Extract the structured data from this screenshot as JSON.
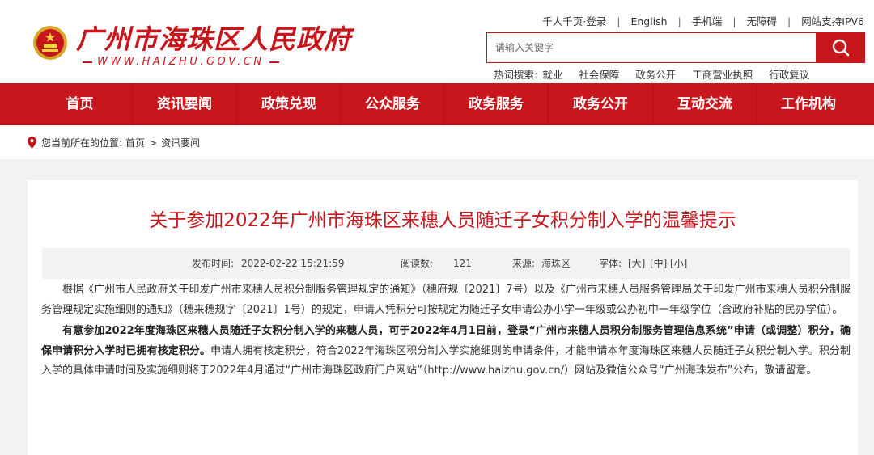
{
  "header": {
    "site_name": "广州市海珠区人民政府",
    "site_url": "WWW.HAIZHU.GOV.CN",
    "top_links": [
      "千人千页·登录",
      "English",
      "手机端",
      "无障碍",
      "网站支持IPV6"
    ],
    "search": {
      "placeholder": "请输入关键字"
    },
    "hot_search": {
      "label": "热词搜索:",
      "terms": [
        "就业",
        "社会保障",
        "政务公开",
        "工商营业执照",
        "行政复议"
      ]
    }
  },
  "nav": {
    "items": [
      "首页",
      "资讯要闻",
      "政策兑现",
      "公众服务",
      "政务服务",
      "政务公开",
      "互动交流",
      "工作机构"
    ]
  },
  "breadcrumb": {
    "label": "您当前所在的位置:",
    "items": [
      "首页",
      "资讯要闻"
    ],
    "sep": ">"
  },
  "article": {
    "title": "关于参加2022年广州市海珠区来穗人员随迁子女积分制入学的温馨提示",
    "meta": {
      "publish_label": "发布时间:",
      "publish_time": "2022-02-22 15:21:59",
      "views_label": "阅读数:",
      "views": "121",
      "source_label": "来源:",
      "source": "海珠区",
      "font_label": "字体:",
      "font_large": "[大]",
      "font_medium": "[中]",
      "font_small": "[小]"
    },
    "para1": "根据《广州市人民政府关于印发广州市来穗人员积分制服务管理规定的通知》（穗府规〔2021〕7号）以及《广州市来穗人员服务管理局关于印发广州市来穗人员积分制服务管理规定实施细则的通知》（穗来穗规字〔2021〕1号）的规定，申请人凭积分可按规定为随迁子女申请公办小学一年级或公办初中一年级学位（含政府补贴的民办学位）。",
    "para2_bold": "有意参加2022年度海珠区来穗人员随迁子女积分制入学的来穗人员，可于2022年4月1日前，登录“广州市来穗人员积分制服务管理信息系统”申请（或调整）积分，确保申请积分入学时已拥有核定积分。",
    "para2_rest": "申请人拥有核定积分，符合2022年海珠区积分制入学实施细则的申请条件，才能申请本年度海珠区来穗人员随迁子女积分制入学。积分制入学的具体申请时间及实施细则将于2022年4月通过“广州市海珠区政府门户网站”（http://www.haizhu.gov.cn/）网站及微信公众号“广州海珠发布”公布，敬请留意。"
  },
  "colors": {
    "brand_red": "#c8161d",
    "page_bg": "#f2f2f2"
  }
}
